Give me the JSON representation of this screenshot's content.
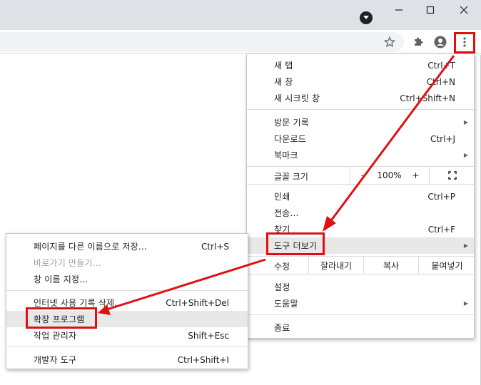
{
  "window": {
    "profile_icon": "profile-dot-icon",
    "minimize_glyph": "—",
    "maximize_glyph": "☐",
    "close_glyph": "✕"
  },
  "toolbar": {
    "star_glyph": "☆",
    "kebab_glyph": "⋮"
  },
  "main_menu": {
    "new_tab": {
      "label": "새 탭",
      "shortcut": "Ctrl+T"
    },
    "new_window": {
      "label": "새 창",
      "shortcut": "Ctrl+N"
    },
    "incognito": {
      "label": "새 시크릿 창",
      "shortcut": "Ctrl+Shift+N"
    },
    "history": {
      "label": "방문 기록"
    },
    "downloads": {
      "label": "다운로드",
      "shortcut": "Ctrl+J"
    },
    "bookmarks": {
      "label": "북마크"
    },
    "zoom": {
      "label": "글꼴 크기",
      "minus": "–",
      "value": "100%",
      "plus": "+",
      "fullscreen": "⛶"
    },
    "print": {
      "label": "인쇄",
      "shortcut": "Ctrl+P"
    },
    "cast": {
      "label": "전송..."
    },
    "find": {
      "label": "찾기",
      "shortcut": "Ctrl+F"
    },
    "more_tools": {
      "label": "도구 더보기"
    },
    "edit": {
      "label": "수정",
      "cut": "잘라내기",
      "copy": "복사",
      "paste": "붙여넣기"
    },
    "settings": {
      "label": "설정"
    },
    "help": {
      "label": "도움말"
    },
    "exit": {
      "label": "종료"
    }
  },
  "sub_menu": {
    "save_page": {
      "label": "페이지를 다른 이름으로 저장...",
      "shortcut": "Ctrl+S"
    },
    "create_shortcut": {
      "label": "바로가기 만들기..."
    },
    "name_window": {
      "label": "창 이름 지정..."
    },
    "clear_data": {
      "label": "인터넷 사용 기록 삭제...",
      "shortcut": "Ctrl+Shift+Del"
    },
    "extensions": {
      "label": "확장 프로그램"
    },
    "task_manager": {
      "label": "작업 관리자",
      "shortcut": "Shift+Esc"
    },
    "dev_tools": {
      "label": "개발자 도구",
      "shortcut": "Ctrl+Shift+I"
    }
  },
  "colors": {
    "annotation": "#e01010",
    "titlebar": "#dee1e6",
    "highlight": "#e8e8e8"
  }
}
